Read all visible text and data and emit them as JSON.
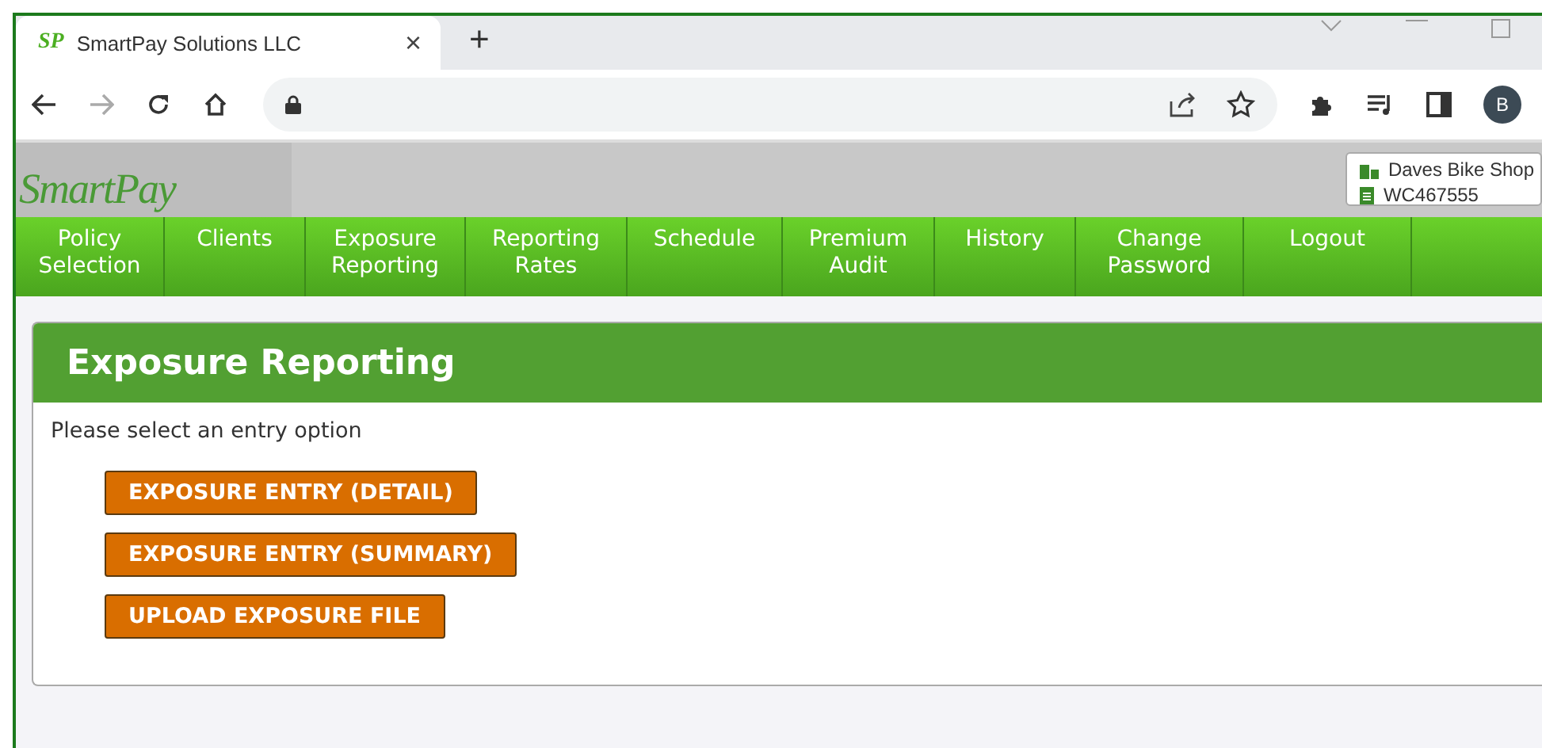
{
  "browser": {
    "tab": {
      "favicon_text": "SP",
      "title": "SmartPay Solutions LLC",
      "close": "×"
    },
    "new_tab": "+",
    "avatar": "B"
  },
  "header": {
    "logo": "SmartPay",
    "account": {
      "name": "Daves Bike Shop",
      "policy": "WC467555"
    }
  },
  "nav": [
    {
      "label": "Policy Selection"
    },
    {
      "label": "Clients"
    },
    {
      "label": "Exposure Reporting"
    },
    {
      "label": "Reporting Rates"
    },
    {
      "label": "Schedule"
    },
    {
      "label": "Premium Audit"
    },
    {
      "label": "History"
    },
    {
      "label": "Change Password"
    },
    {
      "label": "Logout"
    }
  ],
  "panel": {
    "title": "Exposure Reporting",
    "prompt": "Please select an entry option",
    "buttons": [
      "EXPOSURE ENTRY (DETAIL)",
      "EXPOSURE ENTRY (SUMMARY)",
      "UPLOAD EXPOSURE FILE"
    ]
  }
}
